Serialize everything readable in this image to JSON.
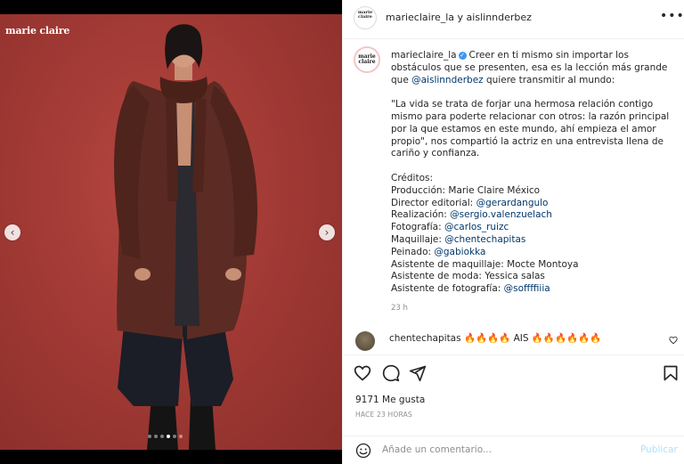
{
  "media": {
    "brand": "marie claire",
    "prev_icon": "chevron-left-icon",
    "next_icon": "chevron-right-icon",
    "carousel": {
      "count": 6,
      "active": 3
    }
  },
  "header": {
    "title": "marieclaire_la y aislinnderbez",
    "avatar_text": "marie claire",
    "more_icon": "more-horizontal-icon"
  },
  "caption": {
    "avatar_text": "marie claire",
    "username": "marieclaire_la",
    "line1a": "Creer en ti mismo sin importar los obstáculos que se presenten, esa es la lección más grande que ",
    "line1_mention": "@aislinnderbez",
    "line1b": " quiere transmitir al mundo:",
    "quote": "\"La vida se trata de forjar una hermosa relación contigo mismo para poderte relacionar con otros: la razón principal por la que estamos en este mundo, ahí empieza el amor propio\", nos compartió la actriz en una entrevista llena de cariño y confianza.",
    "credits_title": "Créditos:",
    "credits": [
      {
        "label": "Producción: Marie Claire México",
        "mention": ""
      },
      {
        "label": "Director editorial: ",
        "mention": "@gerardangulo"
      },
      {
        "label": "Realización: ",
        "mention": "@sergio.valenzuelach"
      },
      {
        "label": "Fotografía: ",
        "mention": "@carlos_ruizc"
      },
      {
        "label": "Maquillaje: ",
        "mention": "@chentechapitas"
      },
      {
        "label": "Peinado: ",
        "mention": "@gabiokka"
      },
      {
        "label": "Asistente de maquillaje: Mocte Montoya",
        "mention": ""
      },
      {
        "label": "Asistente de moda: Yessica salas",
        "mention": ""
      },
      {
        "label": "Asistente de fotografía: ",
        "mention": "@soffffiiia"
      }
    ],
    "time": "23 h"
  },
  "comment": {
    "username": "chentechapitas",
    "text": "🔥🔥🔥🔥 AIS 🔥🔥🔥🔥🔥🔥"
  },
  "actions": {
    "like_icon": "heart-icon",
    "comment_icon": "comment-icon",
    "share_icon": "send-icon",
    "save_icon": "bookmark-icon",
    "likes": "9171 Me gusta",
    "posted": "HACE 23 HORAS"
  },
  "comment_bar": {
    "placeholder": "Añade un comentario...",
    "publish": "Publicar",
    "emoji_icon": "emoji-icon"
  },
  "colors": {
    "background_red": "#a23a35",
    "mention": "#00376b",
    "verified": "#3897f0",
    "publish_disabled": "#b2dffc"
  }
}
